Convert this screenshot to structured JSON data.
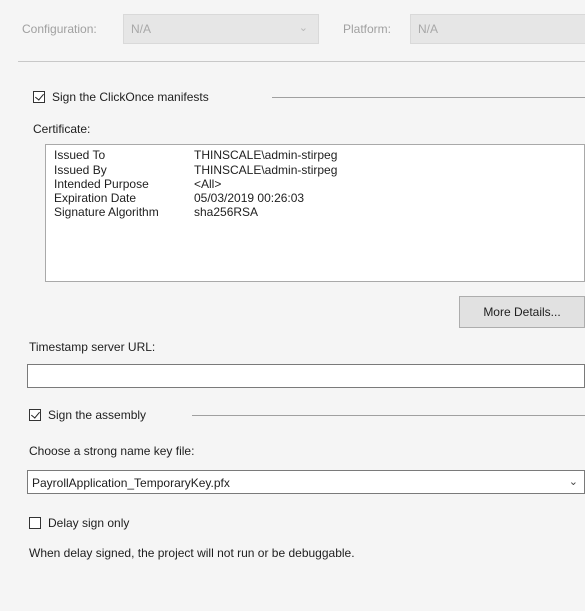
{
  "config": {
    "configuration_label": "Configuration:",
    "configuration_value": "N/A",
    "platform_label": "Platform:",
    "platform_value": "N/A"
  },
  "sign_manifests": {
    "label": "Sign the ClickOnce manifests",
    "checked": true
  },
  "certificate": {
    "label": "Certificate:",
    "rows": [
      {
        "key": "Issued To",
        "value": "THINSCALE\\admin-stirpeg"
      },
      {
        "key": "Issued By",
        "value": "THINSCALE\\admin-stirpeg"
      },
      {
        "key": "Intended Purpose",
        "value": "<All>"
      },
      {
        "key": "Expiration Date",
        "value": "05/03/2019 00:26:03"
      },
      {
        "key": "Signature Algorithm",
        "value": "sha256RSA"
      }
    ],
    "more_details_label": "More Details..."
  },
  "timestamp": {
    "label": "Timestamp server URL:",
    "value": ""
  },
  "sign_assembly": {
    "label": "Sign the assembly",
    "checked": true
  },
  "strong_name": {
    "label": "Choose a strong name key file:",
    "value": "PayrollApplication_TemporaryKey.pfx"
  },
  "delay_sign": {
    "label": "Delay sign only",
    "checked": false,
    "note": "When delay signed, the project will not run or be debuggable."
  },
  "icons": {
    "dropdown": "chevron-down-icon",
    "check": "checkmark-icon"
  }
}
